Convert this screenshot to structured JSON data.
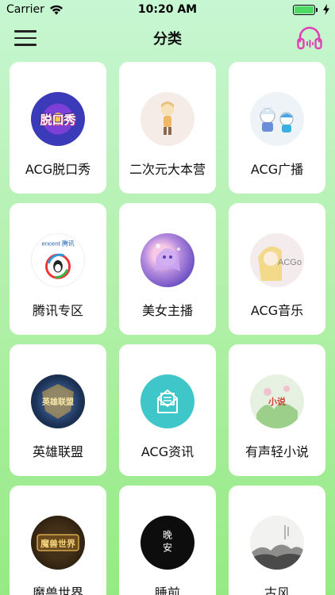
{
  "status_bar": {
    "carrier": "Carrier",
    "time": "10:20 AM",
    "battery_level": 1.0
  },
  "nav": {
    "title": "分类",
    "left_icon": "menu-icon",
    "right_icon": "headphones-icon",
    "accent_color": "#e13fb4"
  },
  "categories": [
    {
      "label": "ACG脱口秀",
      "avatar_text": "脱口秀"
    },
    {
      "label": "二次元大本营"
    },
    {
      "label": "ACG广播"
    },
    {
      "label": "腾讯专区",
      "avatar_text": "encent 腾讯"
    },
    {
      "label": "美女主播"
    },
    {
      "label": "ACG音乐",
      "avatar_text": "ACGo"
    },
    {
      "label": "英雄联盟",
      "avatar_text": "英雄联盟"
    },
    {
      "label": "ACG资讯"
    },
    {
      "label": "有声轻小说",
      "avatar_text": "小说"
    },
    {
      "label": "魔兽世界",
      "avatar_text": "魔兽世界"
    },
    {
      "label": "睡前",
      "avatar_text": "晚安"
    },
    {
      "label": "古风"
    }
  ]
}
